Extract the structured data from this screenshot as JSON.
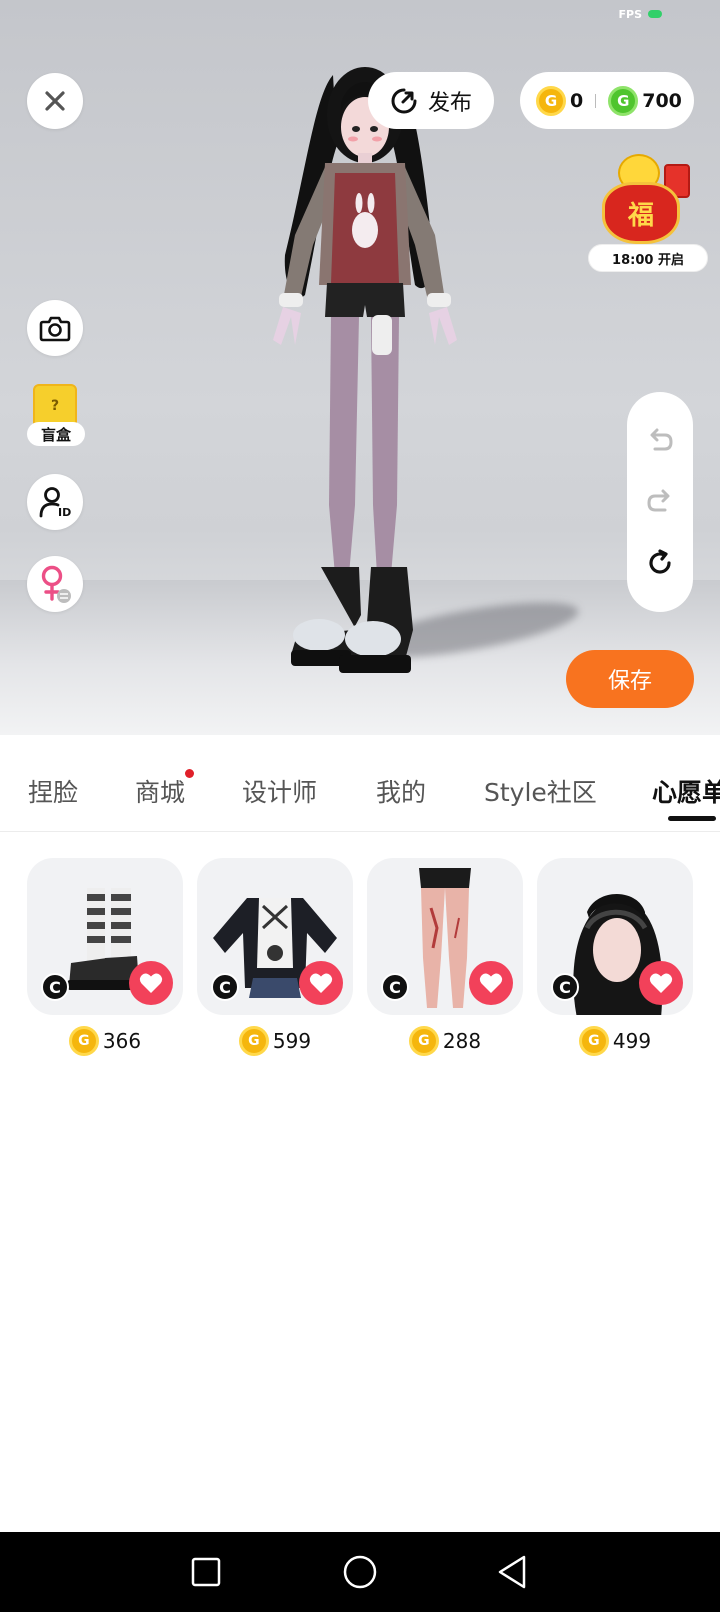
{
  "status": {
    "fps_label": "FPS"
  },
  "toolbar": {
    "publish_label": "发布",
    "gold_amount": "0",
    "green_amount": "700",
    "gold_symbol": "G",
    "green_symbol": "G"
  },
  "side": {
    "blindbox_label": "盲盒",
    "blindbox_symbol": "?"
  },
  "fortune": {
    "time_label": "18:00 开启",
    "bag_char": "福"
  },
  "save_label": "保存",
  "tabs": [
    {
      "label": "捏脸"
    },
    {
      "label": "商城",
      "has_dot": true
    },
    {
      "label": "设计师"
    },
    {
      "label": "我的"
    },
    {
      "label": "Style社区"
    },
    {
      "label": "心愿单",
      "active": true
    }
  ],
  "items": [
    {
      "kind": "shoes-with-socks",
      "price": "366",
      "badge": "C"
    },
    {
      "kind": "jacket",
      "price": "599",
      "badge": "C"
    },
    {
      "kind": "tights",
      "price": "288",
      "badge": "C"
    },
    {
      "kind": "hair",
      "price": "499",
      "badge": "C"
    }
  ],
  "colors": {
    "accent_orange": "#f8731f",
    "heart_red": "#f2415a",
    "gold_coin": "#f5b60d",
    "green_coin": "#4fc52d",
    "dot_red": "#e0202a"
  }
}
